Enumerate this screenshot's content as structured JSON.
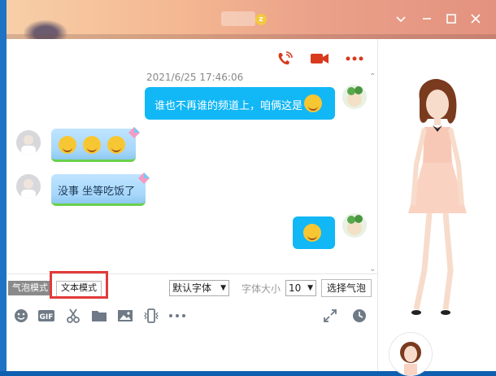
{
  "window": {
    "controls": [
      "collapse",
      "minimize",
      "maximize",
      "close"
    ]
  },
  "header": {
    "vip_badge": "z"
  },
  "chat": {
    "timestamp": "2021/6/25 17:46:06",
    "messages": [
      {
        "side": "out",
        "text": "谁也不再谁的频道上，咱俩这是"
      },
      {
        "side": "in",
        "text": ""
      },
      {
        "side": "in",
        "text": "没事 坐等吃饭了"
      },
      {
        "side": "out",
        "text": ""
      }
    ]
  },
  "toolbar": {
    "bubble_mode": "气泡模式",
    "text_mode": "文本模式",
    "font_select": "默认字体",
    "font_size_label": "字体大小",
    "font_size": "10",
    "choose_bubble": "选择气泡"
  },
  "colors": {
    "accent": "#12b7f5",
    "highlight": "#e23a3a",
    "icon_red": "#d83a1e",
    "icon_gray": "#6f7a86"
  },
  "icons": [
    "phone-icon",
    "video-icon",
    "more-icon",
    "emoji-icon",
    "gif-icon",
    "scissors-icon",
    "folder-icon",
    "image-icon",
    "shake-icon",
    "more-tools-icon",
    "expand-icon",
    "history-icon"
  ]
}
